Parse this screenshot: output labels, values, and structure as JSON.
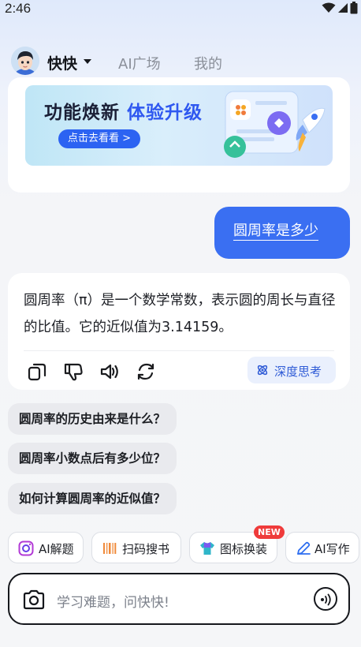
{
  "status_bar": {
    "time": "2:46"
  },
  "nav": {
    "name": "快快",
    "tabs": [
      {
        "label": "AI广场"
      },
      {
        "label": "我的"
      }
    ]
  },
  "banner": {
    "title_main": "功能焕新",
    "title_highlight": "体验升级",
    "button_label": "点击去看看 >"
  },
  "chat": {
    "user_question": "圆周率是多少",
    "answer": "圆周率（π）是一个数学常数，表示圆的周长与直径的比值。它的近似值为3.14159。",
    "deep_think_label": "深度思考"
  },
  "suggestions": [
    "圆周率的历史由来是什么？",
    "圆周率小数点后有多少位？",
    "如何计算圆周率的近似值？"
  ],
  "tools": [
    {
      "label": "AI解题",
      "icon": "camera-square-icon"
    },
    {
      "label": "扫码搜书",
      "icon": "barcode-icon"
    },
    {
      "label": "图标换装",
      "icon": "tshirt-icon",
      "badge": "NEW"
    },
    {
      "label": "AI写作",
      "icon": "pencil-icon"
    }
  ],
  "input": {
    "placeholder": "学习难题，问快快!"
  },
  "colors": {
    "accent": "#3a6ff2",
    "badge": "#ef3b3b",
    "deep_think_bg": "#eaf0fd"
  }
}
